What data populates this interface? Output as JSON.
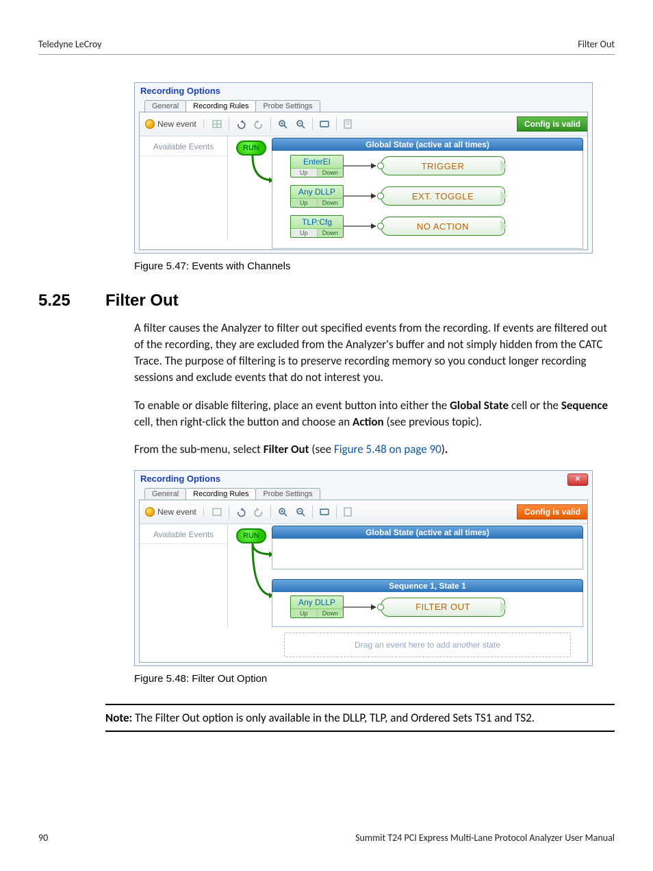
{
  "header": {
    "left": "Teledyne LeCroy",
    "right": "Filter Out"
  },
  "fig47": {
    "windowTitle": "Recording Options",
    "tabs": [
      "General",
      "Recording Rules",
      "Probe Settings"
    ],
    "activeTab": 1,
    "newEvent": "New event",
    "availableEvents": "Available Events",
    "configValid": "Config is valid",
    "run": "RUN",
    "globalHeader": "Global State (active at all times)",
    "events": [
      {
        "label": "EnterEI",
        "upOn": false,
        "downOn": true,
        "action": "TRIGGER"
      },
      {
        "label": "Any DLLP",
        "upOn": true,
        "downOn": true,
        "action": "EXT. TOGGLE"
      },
      {
        "label": "TLP:Cfg",
        "upOn": false,
        "downOn": true,
        "action": "NO ACTION"
      }
    ],
    "caption": "Figure 5.47:  Events with Channels"
  },
  "section": {
    "num": "5.25",
    "title": "Filter Out"
  },
  "para1": "A filter causes the Analyzer to filter out specified events from the recording. If events are filtered out of the recording, they are excluded from the Analyzer's buffer and not simply hidden from the CATC Trace. The purpose of filtering is to preserve recording memory so you conduct longer recording sessions and exclude events that do not interest you.",
  "para2a": "To enable or disable filtering, place an event button into either the ",
  "para2b": " cell or the ",
  "para2c": " cell, then right-click the button and choose an ",
  "para2d": " (see previous topic).",
  "bold": {
    "globalState": "Global State",
    "sequence": "Sequence",
    "action": "Action",
    "filterOut": "Filter Out",
    "noteLabel": "Note:"
  },
  "para3a": "From the sub-menu, select ",
  "para3b": " (see ",
  "link48": "Figure 5.48 on page 90",
  "para3c": ")",
  "fig48": {
    "windowTitle": "Recording Options",
    "tabs": [
      "General",
      "Recording Rules",
      "Probe Settings"
    ],
    "activeTab": 1,
    "newEvent": "New event",
    "availableEvents": "Available Events",
    "configValid": "Config is valid",
    "run": "RUN",
    "globalHeader": "Global State (active at all times)",
    "seqHeader": "Sequence 1, State 1",
    "event": {
      "label": "Any DLLP",
      "upOn": true,
      "downOn": true,
      "action": "FILTER OUT"
    },
    "dropHint": "Drag an event here to add another state",
    "caption": "Figure 5.48:  Filter Out Option"
  },
  "noteText": " The Filter Out option is only available in the DLLP, TLP, and Ordered Sets TS1 and TS2.",
  "footer": {
    "page": "90",
    "manual": "Summit T24 PCI Express Multi-Lane Protocol Analyzer User Manual"
  }
}
